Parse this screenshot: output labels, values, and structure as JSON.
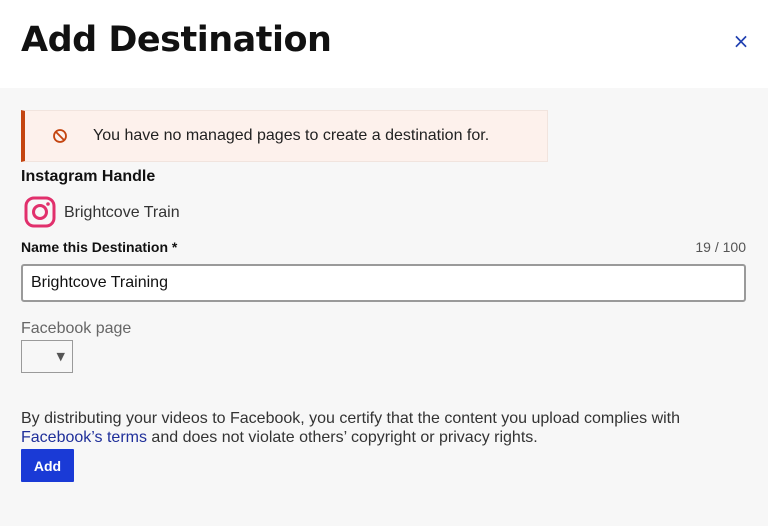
{
  "header": {
    "title": "Add Destination",
    "close_icon": "close-icon",
    "close_glyph": "×"
  },
  "alert": {
    "icon": "no-entry-icon",
    "text": "You have no managed pages to create a destination for."
  },
  "instagram": {
    "label": "Instagram Handle",
    "icon": "instagram-icon",
    "account_name": "Brightcove Train"
  },
  "destination_name": {
    "label": "Name this Destination *",
    "counter": "19 / 100",
    "value": "Brightcove Training"
  },
  "facebook_page": {
    "label": "Facebook page",
    "selected": "",
    "caret": "▼"
  },
  "terms": {
    "before": "By distributing your videos to Facebook, you certify that the content you upload complies with ",
    "link": "Facebook’s terms",
    "after": " and does not violate others’ copyright or privacy rights."
  },
  "actions": {
    "add_label": "Add"
  },
  "colors": {
    "accent": "#1a3ad6",
    "alert_border": "#c44510",
    "alert_bg": "#fdf1ec",
    "instagram": "#e1306c",
    "link": "#1f2f9a"
  }
}
